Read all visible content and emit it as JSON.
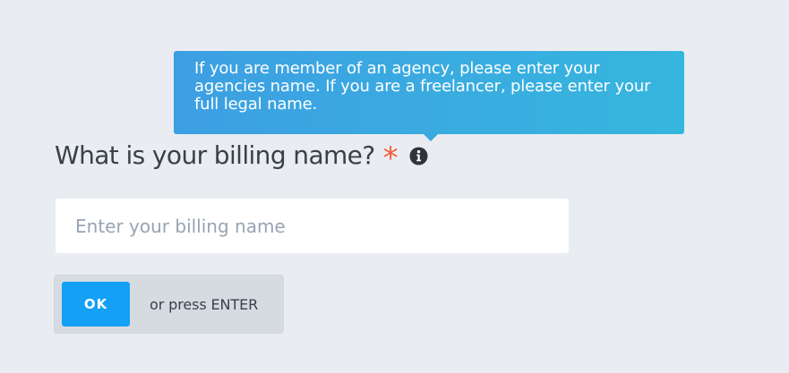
{
  "tooltip": {
    "text": "If you are member of an agency, please enter your agencies name. If you are a freelancer, please enter your full legal name."
  },
  "question": {
    "label": "What is your billing name?",
    "required_mark": "*",
    "info_icon": "info-circle-icon"
  },
  "input": {
    "value": "",
    "placeholder": "Enter your billing name"
  },
  "actions": {
    "ok_label": "OK",
    "hint": "or press ENTER"
  },
  "colors": {
    "background": "#e9edf1",
    "tooltip_start": "#3d9fe3",
    "tooltip_end": "#36b6de",
    "required": "#f0603a",
    "ok_button": "#13a0f5"
  }
}
